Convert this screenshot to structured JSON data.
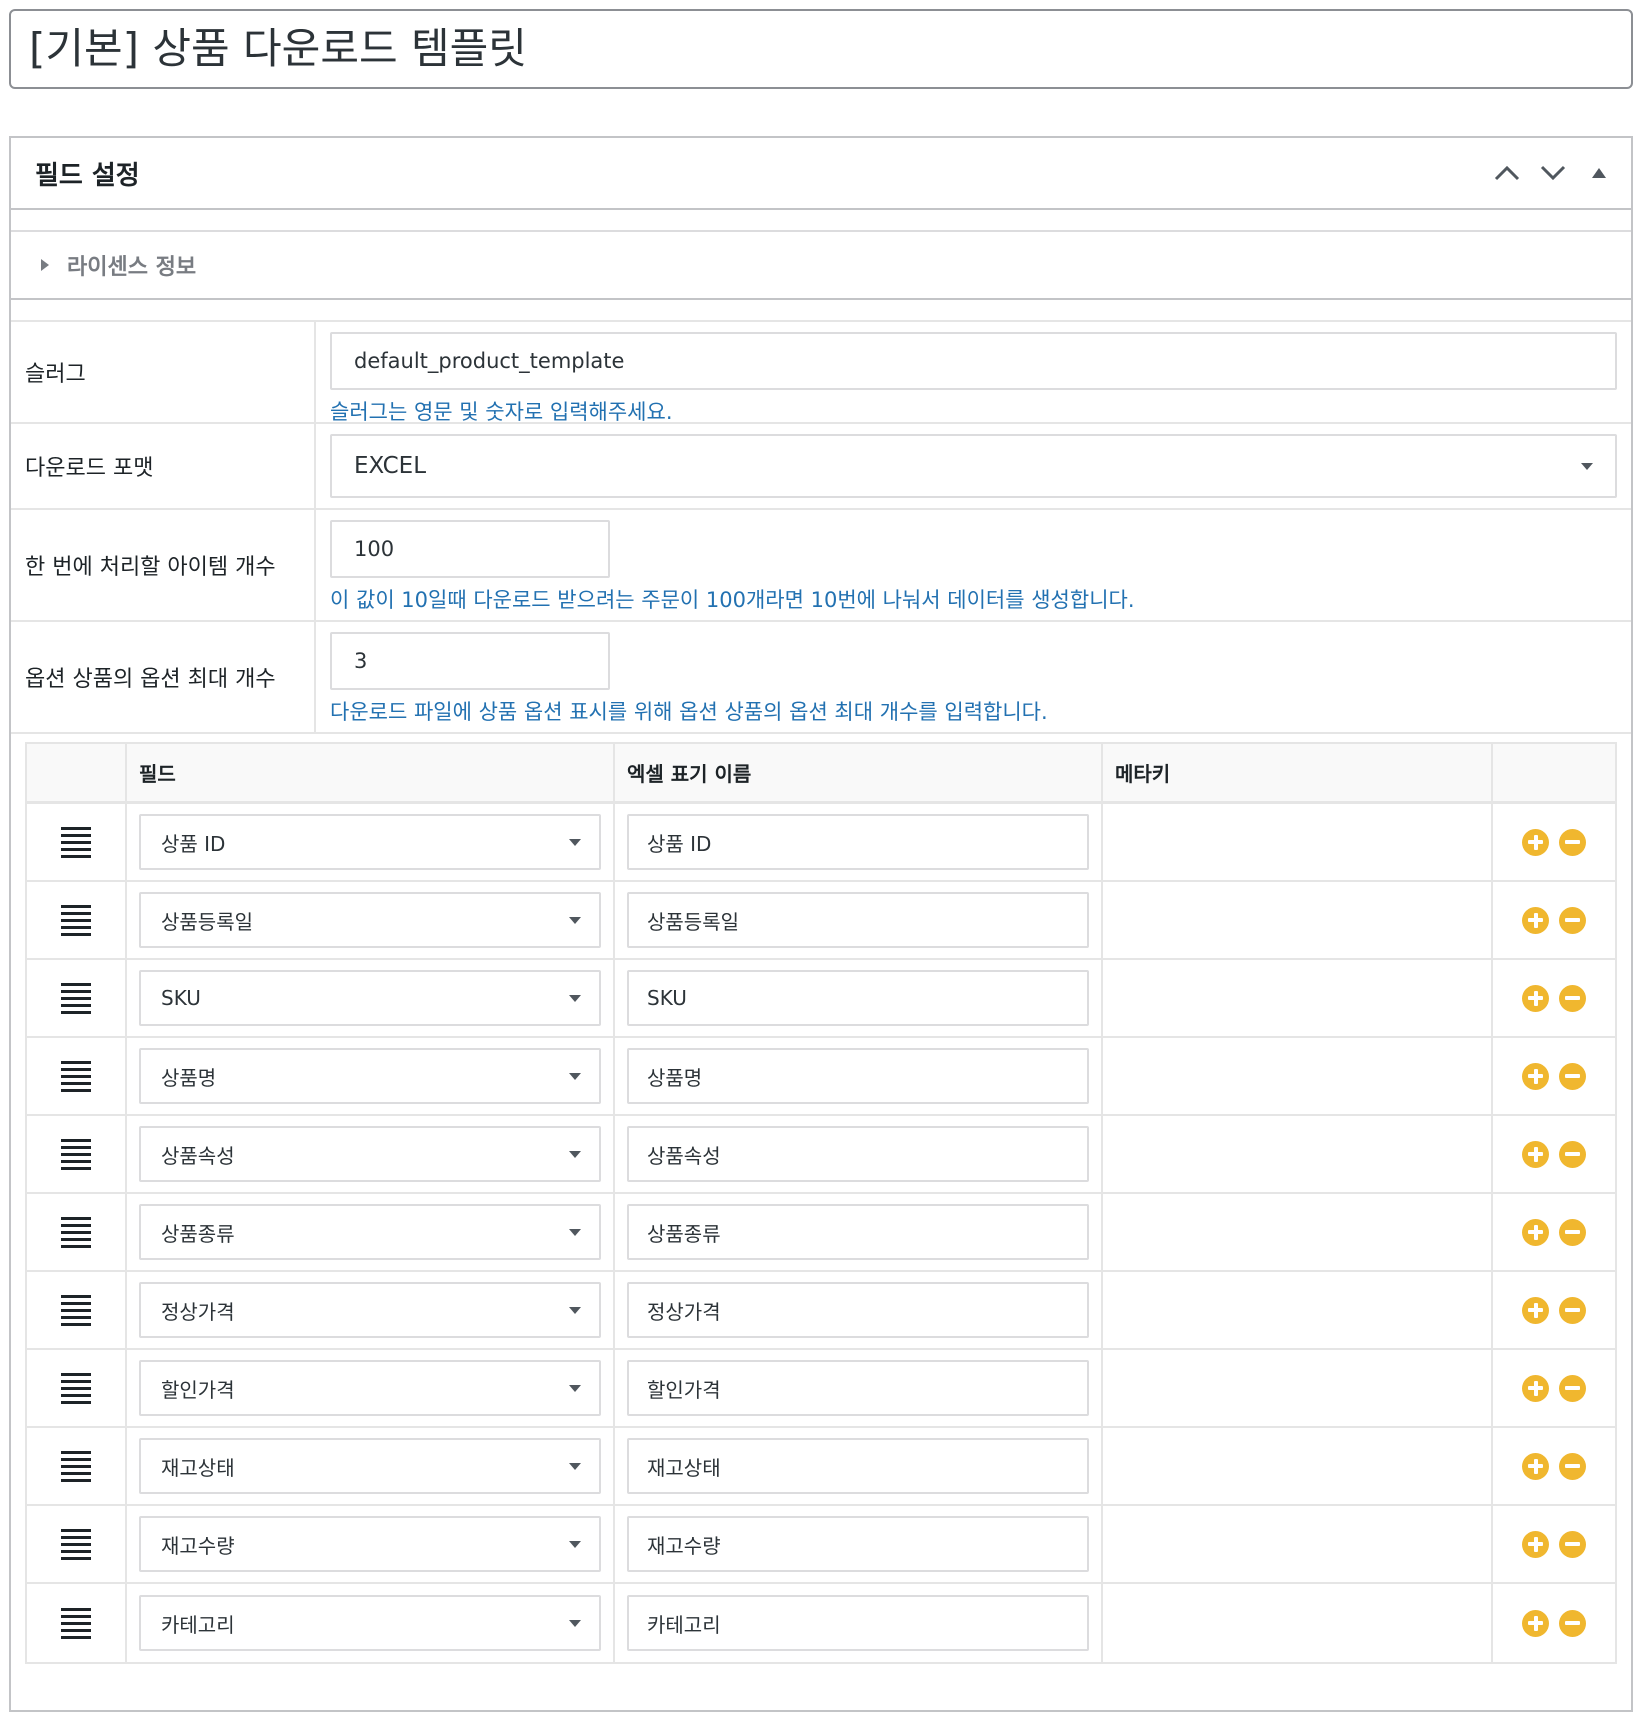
{
  "template_title": "[기본] 상품 다운로드 템플릿",
  "panel": {
    "title": "필드 설정",
    "license_label": "라이센스 정보"
  },
  "form": {
    "slug": {
      "label": "슬러그",
      "value": "default_product_template",
      "help": "슬러그는 영문 및 숫자로 입력해주세요."
    },
    "format": {
      "label": "다운로드 포맷",
      "value": "EXCEL"
    },
    "batch": {
      "label": "한 번에 처리할 아이템 개수",
      "value": "100",
      "help": "이 값이 10일때 다운로드 받으려는 주문이 100개라면 10번에 나눠서 데이터를 생성합니다."
    },
    "max_options": {
      "label": "옵션 상품의 옵션 최대 개수",
      "value": "3",
      "help": "다운로드 파일에 상품 옵션 표시를 위해 옵션 상품의 옵션 최대 개수를 입력합니다."
    }
  },
  "grid": {
    "headers": {
      "field": "필드",
      "excel_name": "엑셀 표기 이름",
      "meta_key": "메타키"
    },
    "rows": [
      {
        "field": "상품 ID",
        "excel_name": "상품 ID"
      },
      {
        "field": "상품등록일",
        "excel_name": "상품등록일"
      },
      {
        "field": "SKU",
        "excel_name": "SKU"
      },
      {
        "field": "상품명",
        "excel_name": "상품명"
      },
      {
        "field": "상품속성",
        "excel_name": "상품속성"
      },
      {
        "field": "상품종류",
        "excel_name": "상품종류"
      },
      {
        "field": "정상가격",
        "excel_name": "정상가격"
      },
      {
        "field": "할인가격",
        "excel_name": "할인가격"
      },
      {
        "field": "재고상태",
        "excel_name": "재고상태"
      },
      {
        "field": "재고수량",
        "excel_name": "재고수량"
      },
      {
        "field": "카테고리",
        "excel_name": "카테고리"
      }
    ]
  },
  "colors": {
    "accent_blue": "#2271b1",
    "action_yellow": "#f0b72f"
  }
}
